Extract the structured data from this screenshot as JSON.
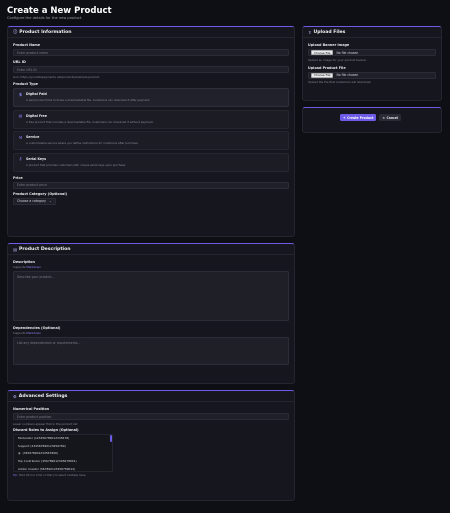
{
  "page": {
    "title": "Create a New Product",
    "subtitle": "Configure the details for the new product."
  },
  "product_info": {
    "header": "Product Information",
    "name_label": "Product Name",
    "name_placeholder": "Enter product name",
    "url_label": "URL ID",
    "url_placeholder": "Enter URL ID",
    "url_hint": "Link: https://yoursitepayments.net/products/example-product",
    "type_label": "Product Type",
    "types": [
      {
        "title": "Digital Paid",
        "desc": "A paid product that includes a downloadable file. Customers can download it after payment.",
        "icon": "dollar-icon",
        "glyph": "$"
      },
      {
        "title": "Digital Free",
        "desc": "A free product that includes a downloadable file. Customers can download it without payment.",
        "icon": "gift-icon",
        "glyph": "▤"
      },
      {
        "title": "Service",
        "desc": "A customizable service where you define instructions for customers after purchase.",
        "icon": "service-icon",
        "glyph": "⚒"
      },
      {
        "title": "Serial Keys",
        "desc": "A product that provides customers with unique serial keys upon purchase.",
        "icon": "key-icon",
        "glyph": "⚷"
      }
    ],
    "price_label": "Price",
    "price_placeholder": "Enter product price",
    "category_label": "Product Category (Optional)",
    "category_value": "Choose a category",
    "category_chevron": "⌄"
  },
  "upload": {
    "header": "Upload Files",
    "banner_label": "Upload Banner Image",
    "banner_button": "Choose File",
    "banner_status": "No file chosen",
    "banner_hint": "Upload an image for your product banner.",
    "file_label": "Upload Product File",
    "file_button": "Choose File",
    "file_status": "No file chosen",
    "file_hint": "Upload the file that customers will download."
  },
  "actions": {
    "create_label": "Create Product",
    "create_glyph": "+",
    "cancel_label": "Cancel",
    "cancel_glyph": "×"
  },
  "description": {
    "header": "Product Description",
    "desc_label": "Description",
    "desc_hint_prefix": "Supports ",
    "desc_hint_link": "Markdown",
    "desc_placeholder": "Describe your product...",
    "deps_label": "Dependencies (Optional)",
    "deps_hint_prefix": "Supports ",
    "deps_hint_link": "Markdown",
    "deps_placeholder": "List any dependencies or requirements..."
  },
  "advanced": {
    "header": "Advanced Settings",
    "position_label": "Numerical Position",
    "position_placeholder": "Enter product position",
    "position_hint": "Lower numbers appear first in the product list",
    "roles_label": "Discord Roles to Assign (Optional)",
    "roles": [
      "Moderator (123456789012345678)",
      "Support (234567890123456789)",
      "(345678901234567890)",
      "Top Contributor (456789012345678901)",
      "Addon Creator (567890123456789012)"
    ],
    "tip_strong": "Tip:",
    "tip_text": " Hold Ctrl (or Cmd on Mac) to select multiple roles."
  },
  "colors": {
    "accent": "#6c5ce7",
    "background": "#0e0f14",
    "card": "#16171e"
  }
}
